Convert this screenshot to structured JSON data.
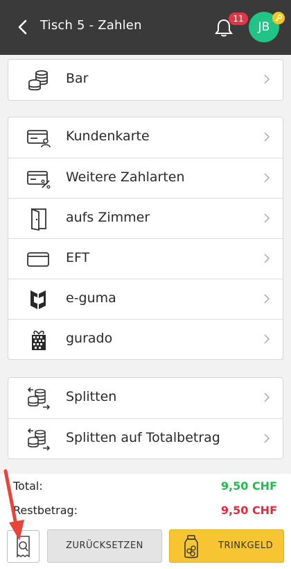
{
  "header": {
    "title": "Tisch 5 - Zahlen",
    "notification_count": "11",
    "avatar_initials": "JB"
  },
  "payment_groups": [
    {
      "items": [
        {
          "label": "Bar",
          "icon": "coins-icon"
        }
      ]
    },
    {
      "items": [
        {
          "label": "Kundenkarte",
          "icon": "customer-card-icon"
        },
        {
          "label": "Weitere Zahlarten",
          "icon": "card-percent-icon"
        },
        {
          "label": "aufs Zimmer",
          "icon": "door-icon"
        },
        {
          "label": "EFT",
          "icon": "credit-card-icon"
        },
        {
          "label": "e-guma",
          "icon": "eguma-logo-icon"
        },
        {
          "label": "gurado",
          "icon": "gift-icon"
        }
      ]
    },
    {
      "items": [
        {
          "label": "Splitten",
          "icon": "split-coins-icon"
        },
        {
          "label": "Splitten auf Totalbetrag",
          "icon": "split-coins-icon"
        }
      ]
    }
  ],
  "summary": {
    "total_label": "Total:",
    "total_value": "9,50 CHF",
    "rest_label": "Restbetrag:",
    "rest_value": "9,50 CHF"
  },
  "buttons": {
    "reset_label": "ZURÜCKSETZEN",
    "tip_label": "TRINKGELD"
  },
  "colors": {
    "header_bg": "#3a3a3a",
    "total_green": "#1fbf4a",
    "rest_red": "#e8283c",
    "tip_yellow": "#f7c531",
    "avatar_green": "#20c486",
    "badge_red": "#e53348"
  }
}
